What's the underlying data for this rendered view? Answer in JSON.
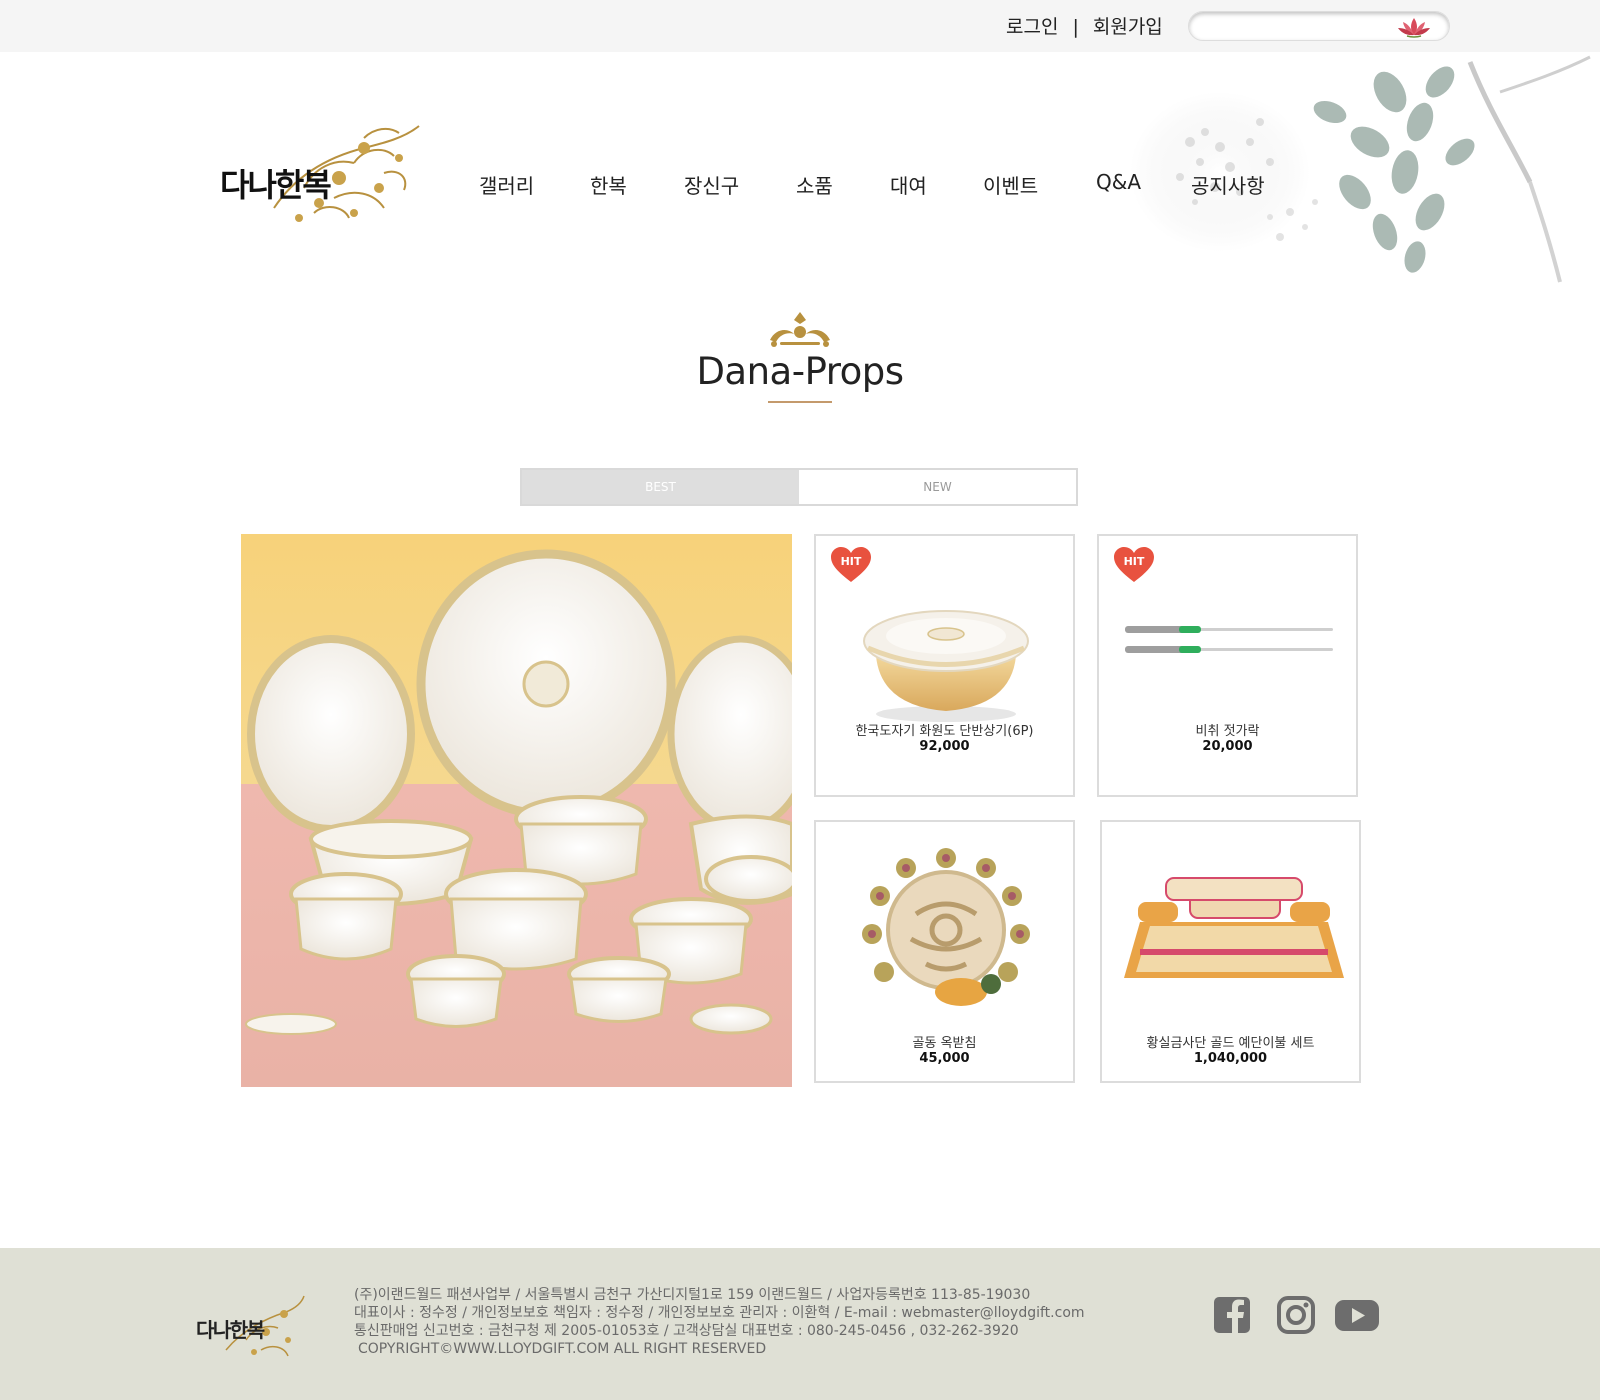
{
  "topbar": {
    "login": "로그인",
    "separator": "|",
    "signup": "회원가입",
    "search_placeholder": ""
  },
  "logo": {
    "text": "다나한복"
  },
  "nav": {
    "items": [
      {
        "label": "갤러리"
      },
      {
        "label": "한복"
      },
      {
        "label": "장신구"
      },
      {
        "label": "소품"
      },
      {
        "label": "대여"
      },
      {
        "label": "이벤트"
      },
      {
        "label": "Q&A"
      },
      {
        "label": "공지사항"
      }
    ]
  },
  "section": {
    "title": "Dana-Props"
  },
  "tabs": [
    {
      "label": "BEST",
      "active": true
    },
    {
      "label": "NEW",
      "active": false
    }
  ],
  "badge": {
    "label": "HIT"
  },
  "products": [
    {
      "name": "한국도자기 화원도 단반상기(6P)",
      "price": "92,000",
      "hit": true,
      "image": "lidded-bowl-icon"
    },
    {
      "name": "비취 젓가락",
      "price": "20,000",
      "hit": true,
      "image": "chopsticks-icon"
    },
    {
      "name": "골동 옥받침",
      "price": "45,000",
      "hit": false,
      "image": "jade-ornament-icon"
    },
    {
      "name": "황실금사단 골드 예단이불 세트",
      "price": "1,040,000",
      "hit": false,
      "image": "bedding-set-icon"
    }
  ],
  "footer": {
    "logo_text": "다나한복",
    "lines": [
      "(주)이랜드월드 패션사업부 / 서울특별시 금천구 가산디지털1로 159 이랜드월드 / 사업자등록번호 113-85-19030",
      "대표이사 : 정수정 / 개인정보보호 책임자 : 정수정 / 개인정보보호 관리자 : 이환혁 / E-mail : webmaster@lloydgift.com",
      "통신판매업 신고번호 : 금천구청 제 2005-01053호 / 고객상담실 대표번호 : 080-245-0456 , 032-262-3920",
      "COPYRIGHT©WWW.LLOYDGIFT.COM ALL RIGHT RESERVED"
    ],
    "social": [
      "facebook-icon",
      "instagram-icon",
      "youtube-icon"
    ]
  },
  "colors": {
    "topbar_bg": "#f5f5f5",
    "accent_gold": "#c49a6c",
    "footer_bg": "#dfe0d5",
    "hit_red": "#e8523f",
    "tab_active": "#dedede"
  }
}
